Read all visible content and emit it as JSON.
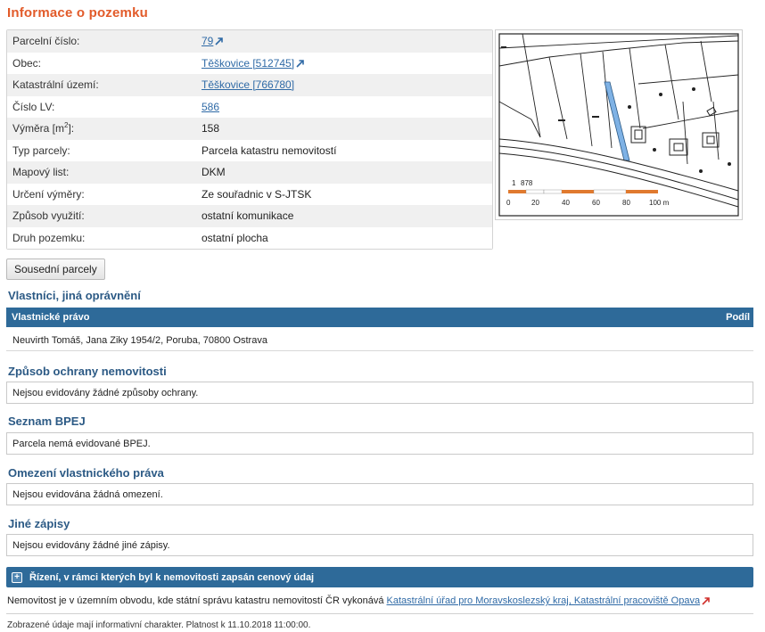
{
  "title": "Informace o pozemku",
  "info": {
    "parcelni_cislo": {
      "label": "Parcelní číslo:",
      "value": "79"
    },
    "obec": {
      "label": "Obec:",
      "value": "Těškovice [512745]"
    },
    "katastralni_uzemi": {
      "label": "Katastrální území:",
      "value": "Těškovice [766780]"
    },
    "cislo_lv": {
      "label": "Číslo LV:",
      "value": "586"
    },
    "vymera": {
      "label_pre": "Výměra [m",
      "label_sup": "2",
      "label_post": "]:",
      "value": "158"
    },
    "typ_parcely": {
      "label": "Typ parcely:",
      "value": "Parcela katastru nemovitostí"
    },
    "mapovy_list": {
      "label": "Mapový list:",
      "value": "DKM"
    },
    "urceni_vymery": {
      "label": "Určení výměry:",
      "value": "Ze souřadnic v S-JTSK"
    },
    "zpusob_vyuziti": {
      "label": "Způsob využití:",
      "value": "ostatní komunikace"
    },
    "druh_pozemku": {
      "label": "Druh pozemku:",
      "value": "ostatní plocha"
    }
  },
  "map": {
    "parcel_label": "878",
    "scale_labels": [
      "0",
      "20",
      "40",
      "60",
      "80",
      "100 m"
    ],
    "highlight_color": "#7fb2e5"
  },
  "neighbors_button": "Sousední parcely",
  "owners": {
    "heading": "Vlastníci, jiná oprávnění",
    "col_right": "Vlastnické právo",
    "col_share": "Podíl",
    "row": "Neuvirth Tomáš, Jana Ziky 1954/2, Poruba, 70800 Ostrava"
  },
  "ochrana": {
    "heading": "Způsob ochrany nemovitosti",
    "text": "Nejsou evidovány žádné způsoby ochrany."
  },
  "bpej": {
    "heading": "Seznam BPEJ",
    "text": "Parcela nemá evidované BPEJ."
  },
  "omezeni": {
    "heading": "Omezení vlastnického práva",
    "text": "Nejsou evidována žádná omezení."
  },
  "jine": {
    "heading": "Jiné zápisy",
    "text": "Nejsou evidovány žádné jiné zápisy."
  },
  "rizeni": {
    "label": "Řízení, v rámci kterých byl k nemovitosti zapsán cenový údaj",
    "icon": "plus-icon"
  },
  "footer": {
    "text": "Nemovitost je v územním obvodu, kde státní správu katastru nemovitostí ČR vykonává ",
    "link": "Katastrální úřad pro Moravskoslezský kraj, Katastrální pracoviště Opava",
    "validity": "Zobrazené údaje mají informativní charakter. Platnost k 11.10.2018 11:00:00."
  },
  "colors": {
    "accent_orange": "#e25b2a",
    "header_blue": "#2e6a99",
    "link_blue": "#2f6aa6"
  }
}
